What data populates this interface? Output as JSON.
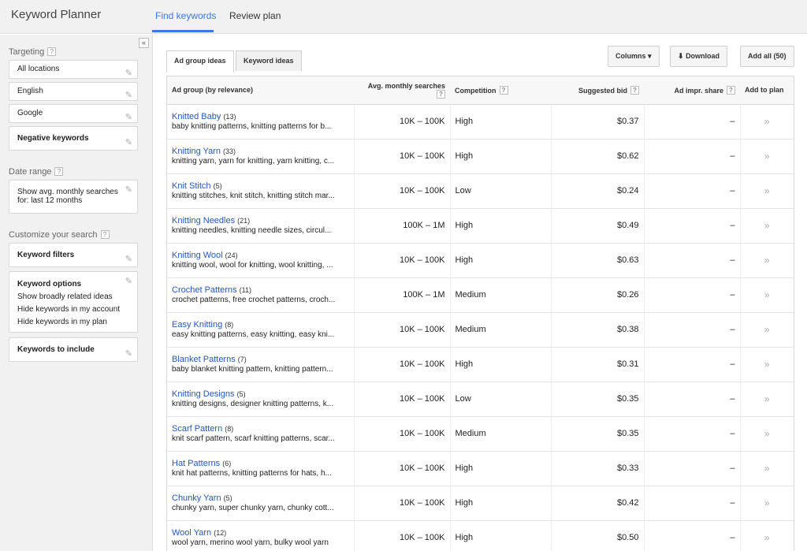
{
  "app_title": "Keyword Planner",
  "nav_tabs": [
    "Find keywords",
    "Review plan"
  ],
  "sidebar": {
    "collapse_symbol": "«",
    "targeting_label": "Targeting",
    "targeting_items": [
      "All locations",
      "English",
      "Google",
      "Negative keywords"
    ],
    "date_range_label": "Date range",
    "date_range_value": [
      "Show avg. monthly searches",
      "for: last 12 months"
    ],
    "customize_label": "Customize your search",
    "keyword_filters": "Keyword filters",
    "keyword_options_title": "Keyword options",
    "keyword_options_lines": [
      "Show broadly related ideas",
      "Hide keywords in my account",
      "Hide keywords in my plan"
    ],
    "keywords_to_include": "Keywords to include",
    "help_glyph": "?"
  },
  "sub_tabs": [
    "Ad group ideas",
    "Keyword ideas"
  ],
  "toolbar": {
    "columns_label": "Columns",
    "download_label": "Download",
    "add_all_label": "Add all (50)"
  },
  "table": {
    "headers": [
      "Ad group (by relevance)",
      "Avg. monthly searches",
      "Competition",
      "Suggested bid",
      "Ad impr. share",
      "Add to plan"
    ],
    "rows": [
      {
        "name": "Knitted Baby",
        "count": "(13)",
        "keywords": "baby knitting patterns, knitting patterns for b...",
        "searches": "10K – 100K",
        "competition": "High",
        "bid": "$0.37",
        "share": "–",
        "add": "»"
      },
      {
        "name": "Knitting Yarn",
        "count": "(33)",
        "keywords": "knitting yarn, yarn for knitting, yarn knitting, c...",
        "searches": "10K – 100K",
        "competition": "High",
        "bid": "$0.62",
        "share": "–",
        "add": "»"
      },
      {
        "name": "Knit Stitch",
        "count": "(5)",
        "keywords": "knitting stitches, knit stitch, knitting stitch mar...",
        "searches": "10K – 100K",
        "competition": "Low",
        "bid": "$0.24",
        "share": "–",
        "add": "»"
      },
      {
        "name": "Knitting Needles",
        "count": "(21)",
        "keywords": "knitting needles, knitting needle sizes, circul...",
        "searches": "100K – 1M",
        "competition": "High",
        "bid": "$0.49",
        "share": "–",
        "add": "»"
      },
      {
        "name": "Knitting Wool",
        "count": "(24)",
        "keywords": "knitting wool, wool for knitting, wool knitting, ...",
        "searches": "10K – 100K",
        "competition": "High",
        "bid": "$0.63",
        "share": "–",
        "add": "»"
      },
      {
        "name": "Crochet Patterns",
        "count": "(11)",
        "keywords": "crochet patterns, free crochet patterns, croch...",
        "searches": "100K – 1M",
        "competition": "Medium",
        "bid": "$0.26",
        "share": "–",
        "add": "»"
      },
      {
        "name": "Easy Knitting",
        "count": "(8)",
        "keywords": "easy knitting patterns, easy knitting, easy kni...",
        "searches": "10K – 100K",
        "competition": "Medium",
        "bid": "$0.38",
        "share": "–",
        "add": "»"
      },
      {
        "name": "Blanket Patterns",
        "count": "(7)",
        "keywords": "baby blanket knitting pattern, knitting pattern...",
        "searches": "10K – 100K",
        "competition": "High",
        "bid": "$0.31",
        "share": "–",
        "add": "»"
      },
      {
        "name": "Knitting Designs",
        "count": "(5)",
        "keywords": "knitting designs, designer knitting patterns, k...",
        "searches": "10K – 100K",
        "competition": "Low",
        "bid": "$0.35",
        "share": "–",
        "add": "»"
      },
      {
        "name": "Scarf Pattern",
        "count": "(8)",
        "keywords": "knit scarf pattern, scarf knitting patterns, scar...",
        "searches": "10K – 100K",
        "competition": "Medium",
        "bid": "$0.35",
        "share": "–",
        "add": "»"
      },
      {
        "name": "Hat Patterns",
        "count": "(6)",
        "keywords": "knit hat patterns, knitting patterns for hats, h...",
        "searches": "10K – 100K",
        "competition": "High",
        "bid": "$0.33",
        "share": "–",
        "add": "»"
      },
      {
        "name": "Chunky Yarn",
        "count": "(5)",
        "keywords": "chunky yarn, super chunky yarn, chunky cott...",
        "searches": "10K – 100K",
        "competition": "High",
        "bid": "$0.42",
        "share": "–",
        "add": "»"
      },
      {
        "name": "Wool Yarn",
        "count": "(12)",
        "keywords": "wool yarn, merino wool yarn, bulky wool yarn",
        "searches": "10K – 100K",
        "competition": "High",
        "bid": "$0.50",
        "share": "–",
        "add": "»"
      }
    ]
  },
  "colors": {
    "accent": "#3b78e7",
    "link": "#2256c6"
  }
}
